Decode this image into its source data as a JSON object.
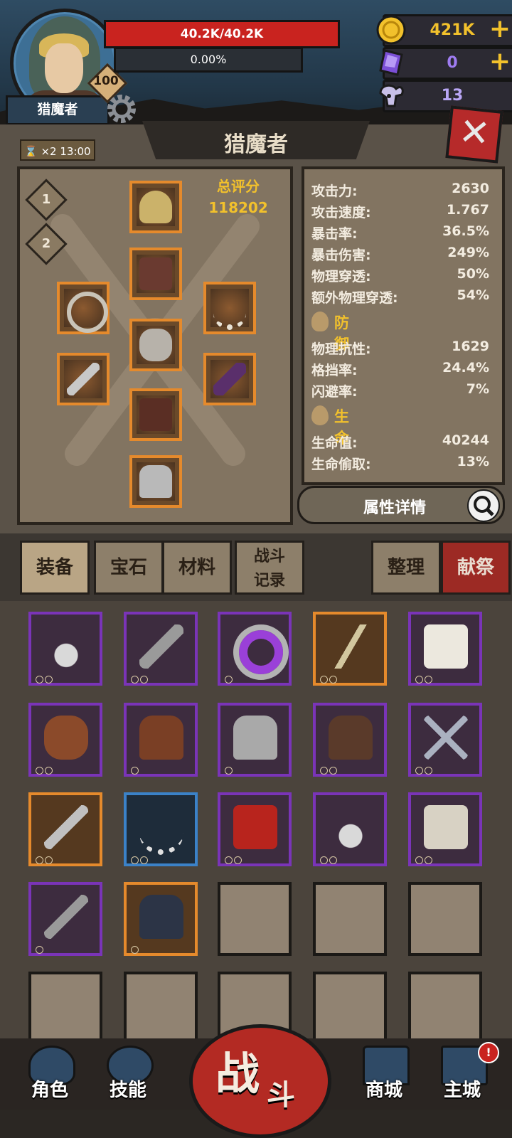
{
  "header": {
    "character_name": "猎魔者",
    "level": "100",
    "hp_text": "40.2K/40.2K",
    "xp_text": "0.00%",
    "resources": [
      {
        "name": "gold-coin-icon",
        "value": "421K",
        "has_plus": true
      },
      {
        "name": "purple-crystal-icon",
        "value": "0",
        "has_plus": true
      },
      {
        "name": "ram-skull-icon",
        "value": "13",
        "has_plus": false
      }
    ],
    "colors": {
      "gold": "#f2c12c",
      "crystal": "#9f7cf2",
      "skull": "#b9a6f5",
      "hp": "#c9231f"
    }
  },
  "panel": {
    "title": "猎魔者",
    "close_icon": "close-x-icon",
    "boost": {
      "multiplier": "×2",
      "time": "13:00"
    },
    "presets": [
      "1",
      "2"
    ],
    "score_label": "总评分",
    "score_value": "118202",
    "attack_stats": [
      {
        "label": "攻击力:",
        "value": "2630"
      },
      {
        "label": "攻击速度:",
        "value": "1.767"
      },
      {
        "label": "暴击率:",
        "value": "36.5%"
      },
      {
        "label": "暴击伤害:",
        "value": "249%"
      },
      {
        "label": "物理穿透:",
        "value": "50%"
      },
      {
        "label": "额外物理穿透:",
        "value": "54%"
      }
    ],
    "defense_title": "防御",
    "defense_stats": [
      {
        "label": "物理抗性:",
        "value": "1629"
      },
      {
        "label": "格挡率:",
        "value": "24.4%"
      },
      {
        "label": "闪避率:",
        "value": "7%"
      }
    ],
    "life_title": "生命",
    "life_stats": [
      {
        "label": "生命值:",
        "value": "40244"
      },
      {
        "label": "生命偷取:",
        "value": "13%"
      }
    ],
    "details_button": "属性详情"
  },
  "tabs": {
    "equipment": "装备",
    "gems": "宝石",
    "materials": "材料",
    "battle_log_1": "战斗",
    "battle_log_2": "记录",
    "sort": "整理",
    "sacrifice": "献祭"
  },
  "nav": {
    "role": "角色",
    "skills": "技能",
    "fight_1": "战",
    "fight_2": "斗",
    "shop": "商城",
    "city": "主城",
    "city_badge": "!"
  }
}
